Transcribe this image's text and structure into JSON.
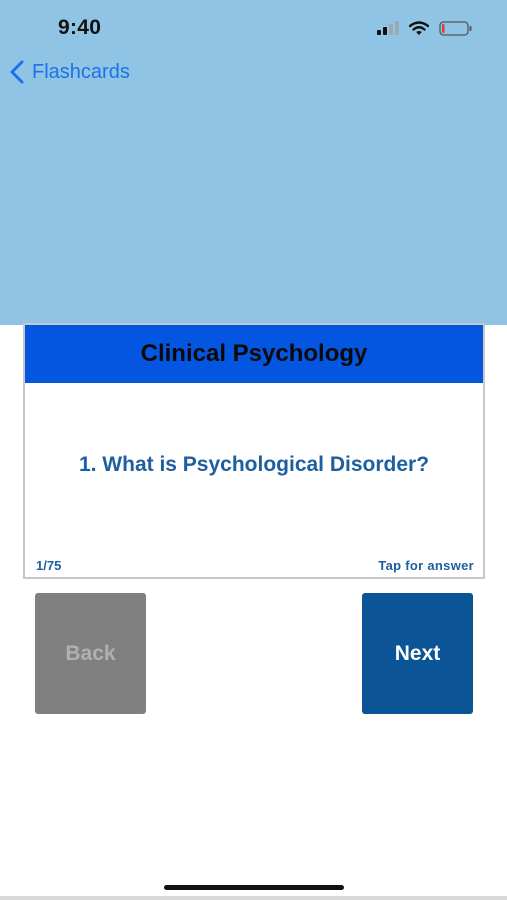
{
  "status_bar": {
    "time": "9:40",
    "icons": [
      "cellular-signal-icon",
      "wifi-icon",
      "battery-icon"
    ]
  },
  "nav": {
    "back_label": "Flashcards",
    "back_icon": "chevron-left-icon"
  },
  "card": {
    "title": "Clinical Psychology",
    "question": "1. What is Psychological Disorder?",
    "counter": "1/75",
    "hint": "Tap for answer"
  },
  "buttons": {
    "back_label": "Back",
    "next_label": "Next"
  },
  "colors": {
    "top_background": "#8fc4e4",
    "card_header": "#0455e0",
    "question_text": "#1e5fa0",
    "next_button": "#0b5596",
    "back_button": "#808080",
    "link_blue": "#1a73e8"
  }
}
